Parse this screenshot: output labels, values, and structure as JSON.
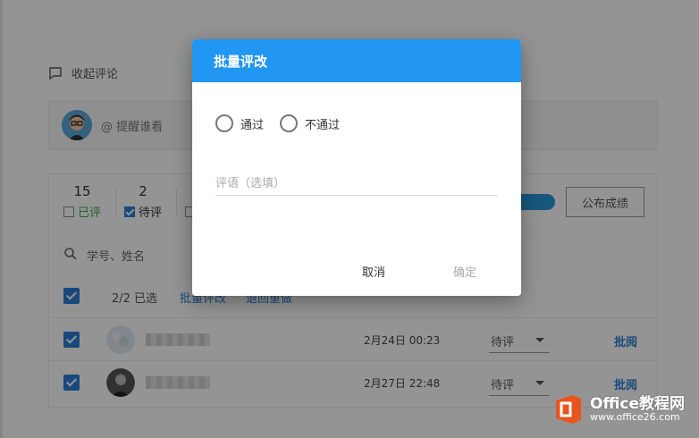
{
  "comments": {
    "collapse_label": "收起评论",
    "mention_placeholder": "@ 提醒谁看"
  },
  "stats": [
    {
      "count": "15",
      "label": "已评",
      "checked": false
    },
    {
      "count": "2",
      "label": "待评",
      "checked": true
    }
  ],
  "publish_button": "公布成绩",
  "search": {
    "placeholder": "学号、姓名"
  },
  "selection": {
    "count_text": "2/2 已选",
    "batch_link": "批量评改",
    "return_link": "退回重做"
  },
  "rows": [
    {
      "date": "2月24日 00:23",
      "status": "待评",
      "action": "批阅"
    },
    {
      "date": "2月27日 22:48",
      "status": "待评",
      "action": "批阅"
    }
  ],
  "dialog": {
    "title": "批量评改",
    "options": [
      "通过",
      "不通过"
    ],
    "comment_placeholder": "评语（选填）",
    "cancel": "取消",
    "confirm": "确定"
  },
  "watermark": {
    "title": "Office教程网",
    "url": "www.office26.com"
  },
  "colors": {
    "primary": "#2196f3",
    "link": "#2b7fd6",
    "overlay": "rgba(0,0,0,0.42)"
  }
}
